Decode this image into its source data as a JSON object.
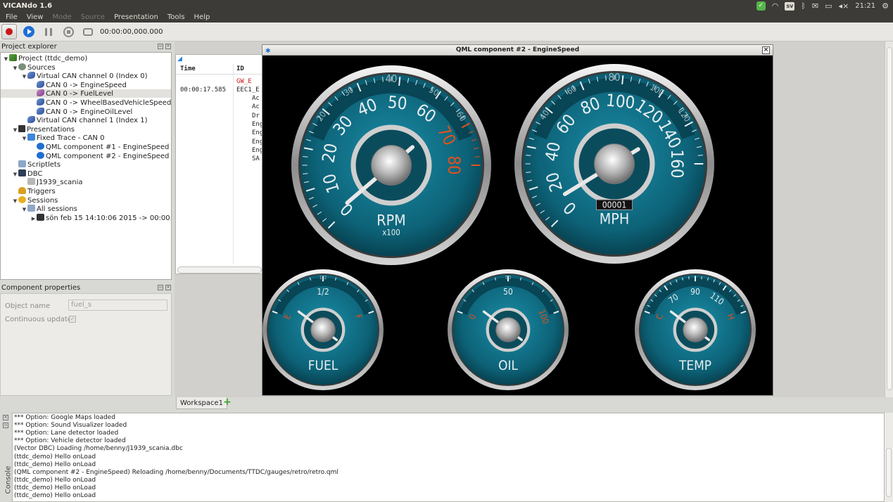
{
  "app": {
    "title": "VICANdo 1.6"
  },
  "tray": {
    "lang": "sv",
    "volume": "◂×",
    "clock": "21:21"
  },
  "menubar": [
    {
      "label": "File",
      "enabled": true
    },
    {
      "label": "View",
      "enabled": true
    },
    {
      "label": "Mode",
      "enabled": false
    },
    {
      "label": "Source",
      "enabled": false
    },
    {
      "label": "Presentation",
      "enabled": true
    },
    {
      "label": "Tools",
      "enabled": true
    },
    {
      "label": "Help",
      "enabled": true
    }
  ],
  "toolbar": {
    "time": "00:00:00,000.000"
  },
  "project_explorer": {
    "title": "Project explorer",
    "items": [
      {
        "label": "Project (ttdc_demo)",
        "depth": 0,
        "arrow": "▼",
        "icon": "project"
      },
      {
        "label": "Sources",
        "depth": 1,
        "arrow": "▼",
        "icon": "sources"
      },
      {
        "label": "Virtual CAN channel 0 (Index 0)",
        "depth": 2,
        "arrow": "▼",
        "icon": "can"
      },
      {
        "label": "CAN 0 -> EngineSpeed",
        "depth": 3,
        "arrow": "",
        "icon": "can"
      },
      {
        "label": "CAN 0 -> FuelLevel",
        "depth": 3,
        "arrow": "",
        "icon": "canpink",
        "selected": true
      },
      {
        "label": "CAN 0 -> WheelBasedVehicleSpeed",
        "depth": 3,
        "arrow": "",
        "icon": "can"
      },
      {
        "label": "CAN 0 -> EngineOilLevel",
        "depth": 3,
        "arrow": "",
        "icon": "can"
      },
      {
        "label": "Virtual CAN channel 1 (Index 1)",
        "depth": 2,
        "arrow": "",
        "icon": "can"
      },
      {
        "label": "Presentations",
        "depth": 1,
        "arrow": "▼",
        "icon": "present"
      },
      {
        "label": "Fixed Trace - CAN 0",
        "depth": 2,
        "arrow": "▼",
        "icon": "trace"
      },
      {
        "label": "QML component #1 - EngineSpeed",
        "depth": 3,
        "arrow": "",
        "icon": "qml"
      },
      {
        "label": "QML component #2 - EngineSpeed",
        "depth": 3,
        "arrow": "",
        "icon": "qml"
      },
      {
        "label": "Scriptlets",
        "depth": 1,
        "arrow": "",
        "icon": "script"
      },
      {
        "label": "DBC",
        "depth": 1,
        "arrow": "▼",
        "icon": "dbc"
      },
      {
        "label": "J1939_scania",
        "depth": 2,
        "arrow": "",
        "icon": "dbcfile"
      },
      {
        "label": "Triggers",
        "depth": 1,
        "arrow": "",
        "icon": "trig"
      },
      {
        "label": "Sessions",
        "depth": 1,
        "arrow": "▼",
        "icon": "sess"
      },
      {
        "label": "All sessions",
        "depth": 2,
        "arrow": "▼",
        "icon": "all"
      },
      {
        "label": "sön feb 15 14:10:06 2015 -> 00:00:0...",
        "depth": 3,
        "arrow": "▶",
        "icon": "film"
      }
    ]
  },
  "component_properties": {
    "title": "Component properties",
    "object_name_label": "Object name",
    "object_name_value": "fuel_s",
    "continuous_update_label": "Continuous update"
  },
  "trace": {
    "col_time": "Time",
    "col_id": "ID",
    "row_gw": "GW_E",
    "row_time": "00:00:17.585",
    "row_id": "EEC1_E",
    "signals": [
      "Ac",
      "Ac",
      "Dr",
      "Eng",
      "Eng",
      "Eng",
      "Eng",
      "SA"
    ]
  },
  "qml_window": {
    "title": "QML component #2 - EngineSpeed"
  },
  "gauges": {
    "rpm": {
      "ticks": [
        "0",
        "10",
        "20",
        "30",
        "40",
        "50",
        "60",
        "70",
        "80"
      ],
      "label": "RPM",
      "sublabel": "x100",
      "top_tick": "40",
      "upper_ring": [
        "20",
        "30",
        "50",
        "60"
      ],
      "value_fraction": 0.02
    },
    "mph": {
      "ticks": [
        "0",
        "20",
        "40",
        "60",
        "80",
        "100",
        "120",
        "140",
        "160"
      ],
      "label": "MPH",
      "top_tick": "80",
      "upper_ring": [
        "40",
        "60",
        "100",
        "120"
      ],
      "odometer": "00001",
      "value_fraction": 0.06
    },
    "fuel": {
      "label": "FUEL",
      "ticks": [
        "E",
        "1/2",
        "F"
      ],
      "top_tick": "1/2",
      "value_fraction": 0.12
    },
    "oil": {
      "label": "OIL",
      "ticks": [
        "0",
        "50",
        "100"
      ],
      "top_tick": "50",
      "value_fraction": 0.12
    },
    "temp": {
      "label": "TEMP",
      "ticks": [
        "C",
        "70",
        "90",
        "110",
        "H"
      ],
      "value_fraction": 0.12
    }
  },
  "workspace": {
    "tab": "Workspace1",
    "add_symbol": "+"
  },
  "console": {
    "label": "Console",
    "lines": [
      "  *** Option: Google Maps loaded",
      "  *** Option: Sound Visualizer loaded",
      "  *** Option: Lane detector loaded",
      "  *** Option: Vehicle detector loaded",
      "(Vector DBC) Loading /home/benny/J1939_scania.dbc",
      "(ttdc_demo) Hello onLoad",
      "(ttdc_demo) Hello onLoad",
      "(QML component #2 - EngineSpeed) Reloading /home/benny/Documents/TTDC/gauges/retro/retro.qml",
      "(ttdc_demo) Hello onLoad",
      "(ttdc_demo) Hello onLoad",
      "(ttdc_demo) Hello onLoad"
    ]
  },
  "colors": {
    "gauge_face": "#0e6f86",
    "gauge_redline": "#e0521e",
    "gauge_text": "#e8eef0"
  }
}
